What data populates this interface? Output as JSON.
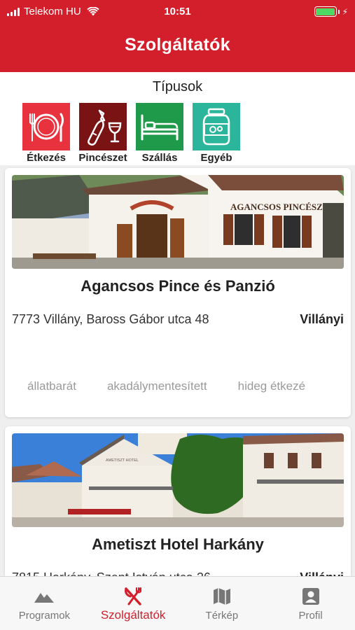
{
  "status": {
    "carrier": "Telekom HU",
    "time": "10:51"
  },
  "header": {
    "title": "Szolgáltatók"
  },
  "types": {
    "title": "Típusok",
    "items": [
      {
        "label": "Étkezés",
        "color": "#e8333f",
        "icon": "plate-cutlery-icon"
      },
      {
        "label": "Pincészet",
        "color": "#7a1313",
        "icon": "wine-bottle-glass-icon"
      },
      {
        "label": "Szállás",
        "color": "#1f9a4b",
        "icon": "bed-icon"
      },
      {
        "label": "Egyéb",
        "color": "#2bb59a",
        "icon": "jar-icon"
      }
    ]
  },
  "cards": [
    {
      "name": "Agancsos Pince és Panzió",
      "address": "7773 Villány, Baross Gábor utca 48",
      "region": "Villányi",
      "photo_sign": "AGANCSOS PINCÉSZET",
      "tags": [
        "állatbarát",
        "akadálymentesített",
        "hideg étkezé"
      ]
    },
    {
      "name": "Ametiszt Hotel Harkány",
      "address": "7815 Harkány, Szent István utca 26",
      "region": "Villányi",
      "photo_sign": "AMETISZT HOTEL",
      "tags": []
    }
  ],
  "tabbar": {
    "active": "Szolgáltatók",
    "items": [
      {
        "label": "Programok",
        "icon": "mountain-icon"
      },
      {
        "label": "Szolgáltatók",
        "icon": "fork-knife-icon"
      },
      {
        "label": "Térkép",
        "icon": "map-icon"
      },
      {
        "label": "Profil",
        "icon": "profile-icon"
      }
    ]
  },
  "colors": {
    "brand": "#d21f2b",
    "tab_inactive": "#777777",
    "battery": "#4cd964"
  }
}
